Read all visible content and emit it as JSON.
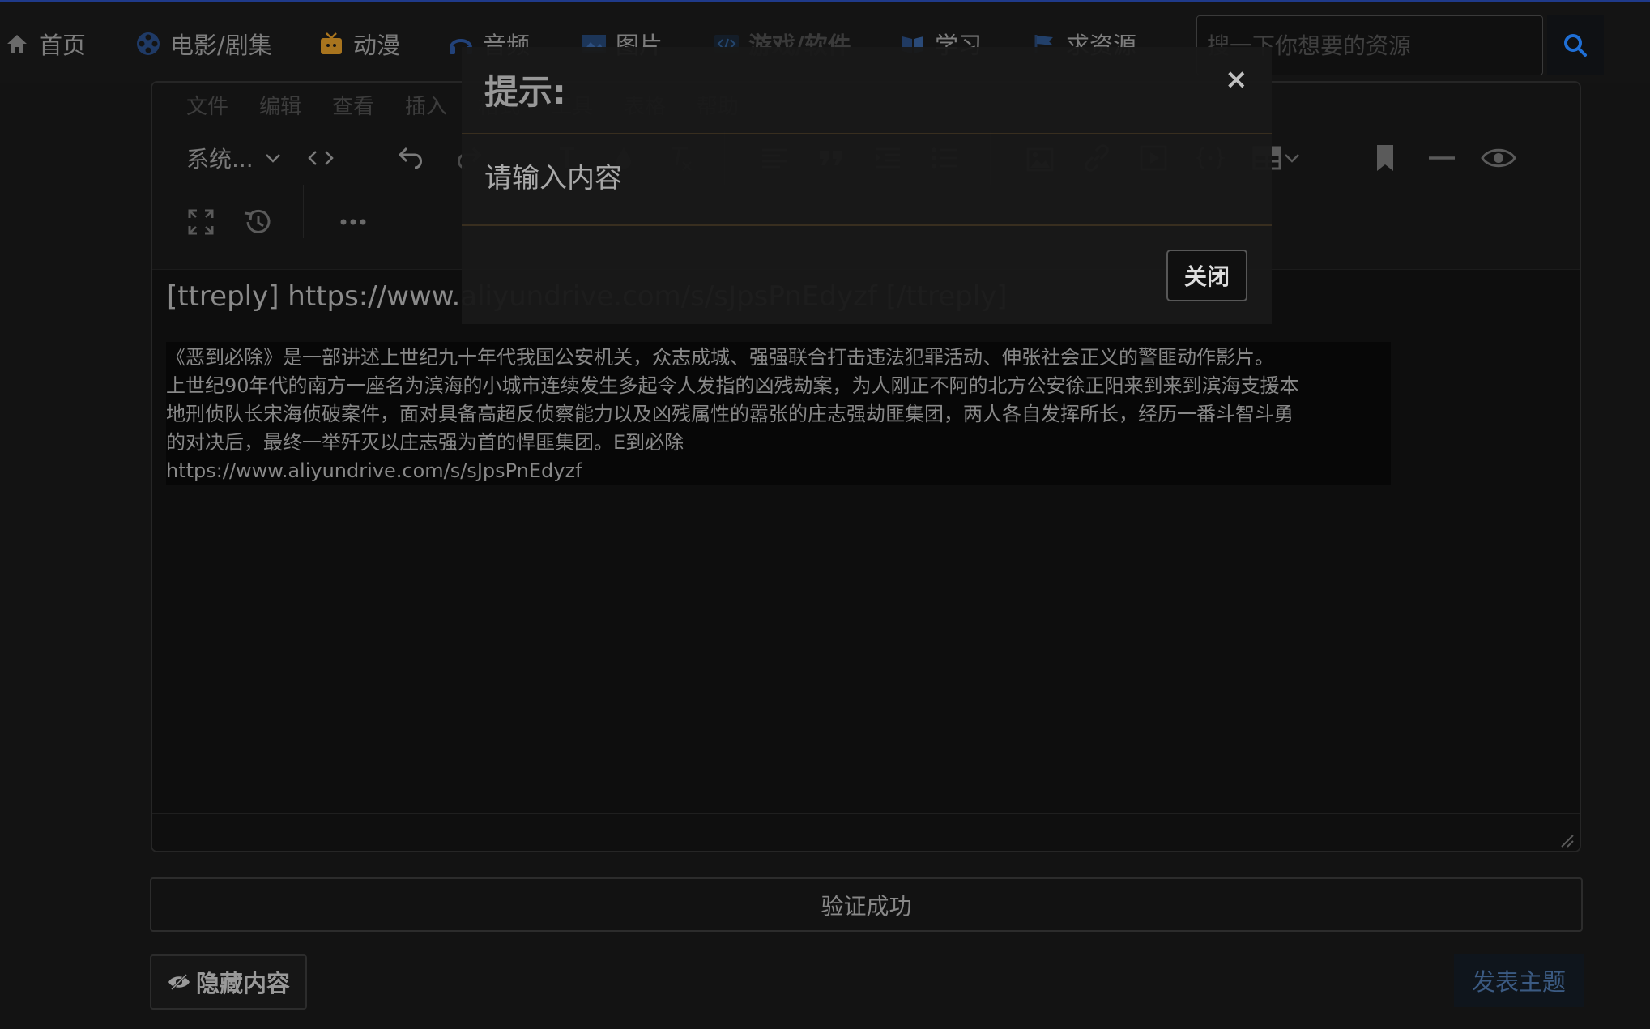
{
  "nav": {
    "items": [
      {
        "label": "首页",
        "icon": "home-icon"
      },
      {
        "label": "电影/剧集",
        "icon": "film-reel-icon"
      },
      {
        "label": "动漫",
        "icon": "tv-icon"
      },
      {
        "label": "音频",
        "icon": "headphones-icon"
      },
      {
        "label": "图片",
        "icon": "image-icon"
      },
      {
        "label": "游戏/软件",
        "icon": "code-icon"
      },
      {
        "label": "学习",
        "icon": "book-icon"
      },
      {
        "label": "求资源",
        "icon": "flag-icon"
      }
    ],
    "search_placeholder": "搜一下你想要的资源"
  },
  "editor": {
    "menu": [
      "文件",
      "编辑",
      "查看",
      "插入",
      "格式",
      "工具",
      "表格",
      "帮助"
    ],
    "font_family": "系统...",
    "content_line": "[ttreply] https://www.aliyundrive.com/s/sJpsPnEdyzf [/ttreply]",
    "quote_lines": [
      "《恶到必除》是一部讲述上世纪九十年代我国公安机关，众志成城、强强联合打击违法犯罪活动、伸张社会正义的警匪动作影片。",
      "上世纪90年代的南方一座名为滨海的小城市连续发生多起令人发指的凶残劫案，为人刚正不阿的北方公安徐正阳来到来到滨海支援本",
      "地刑侦队长宋海侦破案件，面对具备高超反侦察能力以及凶残属性的嚣张的庄志强劫匪集团，两人各自发挥所长，经历一番斗智斗勇",
      "的对决后，最终一举歼灭以庄志强为首的悍匪集团。E到必除",
      "https://www.aliyundrive.com/s/sJpsPnEdyzf"
    ]
  },
  "verify_text": "验证成功",
  "hide_button": "隐藏内容",
  "publish_button": "发表主题",
  "modal": {
    "title": "提示:",
    "close_glyph": "×",
    "message": "请输入内容",
    "button": "关闭"
  },
  "colors": {
    "background": "#131313",
    "accent_blue": "#1f6fd6",
    "modal_rule": "#3a3020"
  }
}
